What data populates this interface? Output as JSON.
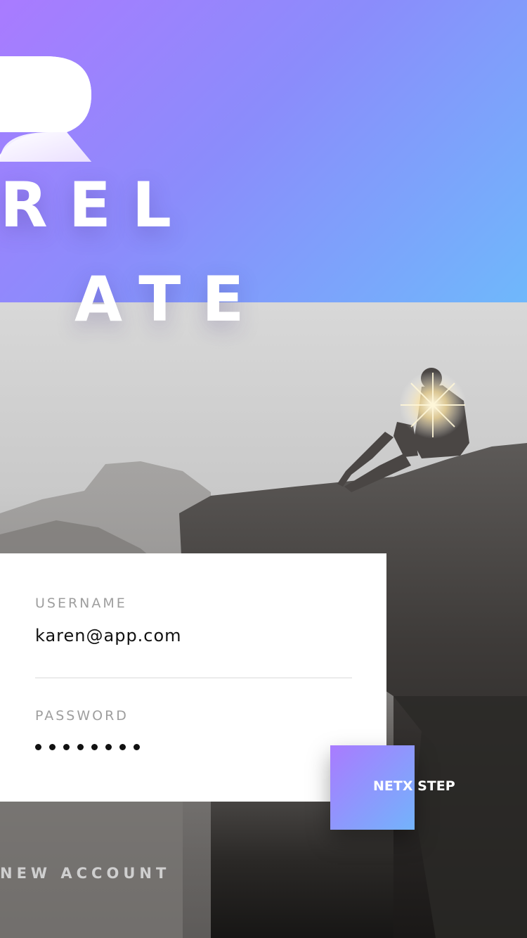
{
  "brand": {
    "line1": "REL",
    "line2": "ATE"
  },
  "form": {
    "username_label": "USERNAME",
    "username_value": "karen@app.com",
    "password_label": "PASSWORD",
    "password_mask_count": 8
  },
  "actions": {
    "next_label": "NETX STEP",
    "new_account_label": "NEW ACCOUNT"
  },
  "colors": {
    "gradient_start": "#a97bff",
    "gradient_end": "#6fb8fb"
  },
  "icons": {
    "logo": "relate-logo-mark"
  }
}
